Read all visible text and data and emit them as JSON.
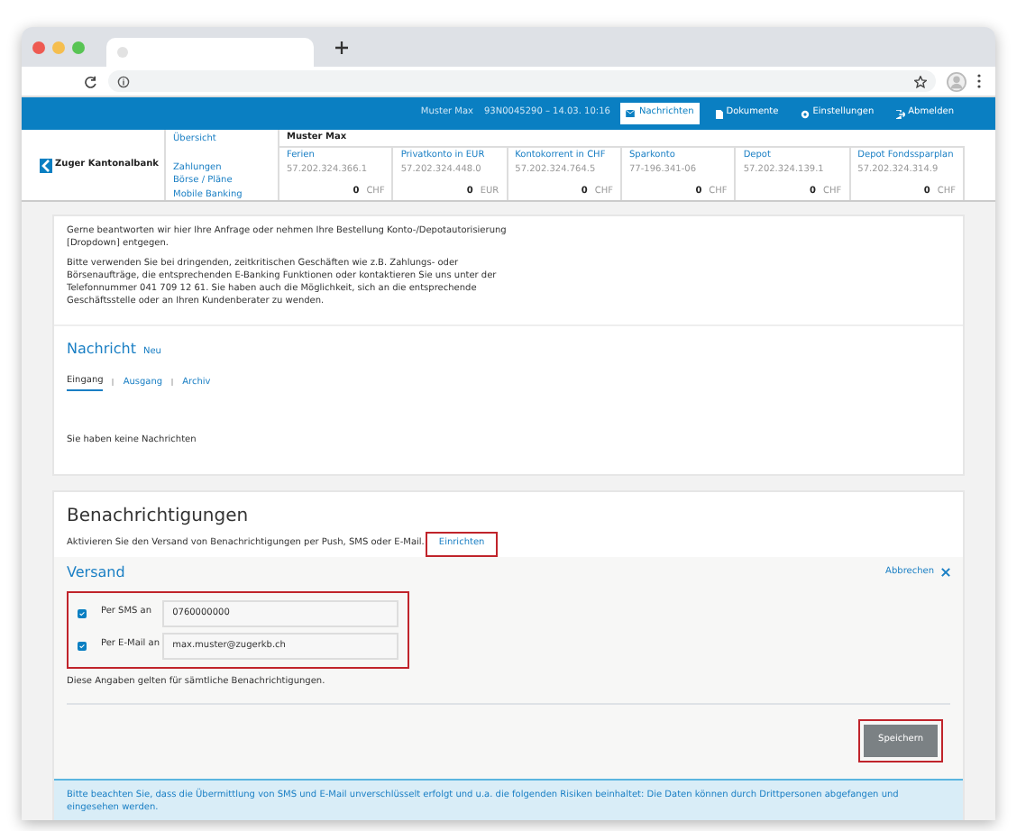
{
  "header": {
    "user": "Muster Max",
    "session": "93N0045290 – 14.03. 10:16",
    "menu": [
      {
        "label": "Nachrichten",
        "selected": true
      },
      {
        "label": "Dokumente",
        "selected": false
      },
      {
        "label": "Einstellungen",
        "selected": false
      },
      {
        "label": "Abmelden",
        "selected": false
      }
    ]
  },
  "nav": {
    "logo": "Zuger Kantonalbank",
    "top_link": "Übersicht",
    "links": [
      "Zahlungen",
      "Börse / Pläne",
      "Mobile Banking"
    ],
    "holder": "Muster Max",
    "accounts": [
      {
        "name": "Ferien",
        "number": "57.202.324.366.1",
        "balance": "0",
        "currency": "CHF"
      },
      {
        "name": "Privatkonto in EUR",
        "number": "57.202.324.448.0",
        "balance": "0",
        "currency": "EUR"
      },
      {
        "name": "Kontokorrent in CHF",
        "number": "57.202.324.764.5",
        "balance": "0",
        "currency": "CHF"
      },
      {
        "name": "Sparkonto",
        "number": "77-196.341-06",
        "balance": "0",
        "currency": "CHF"
      },
      {
        "name": "Depot",
        "number": "57.202.324.139.1",
        "balance": "0",
        "currency": "CHF"
      },
      {
        "name": "Depot Fondssparplan",
        "number": "57.202.324.314.9",
        "balance": "0",
        "currency": "CHF"
      }
    ]
  },
  "intro": [
    "Gerne beantworten wir hier Ihre Anfrage oder nehmen Ihre Bestellung Konto-/Depotautorisierung [Dropdown] entgegen.",
    "Bitte verwenden Sie bei dringenden, zeitkritischen Geschäften wie z.B. Zahlungs- oder Börsenaufträge, die entsprechenden E-Banking Funktionen oder kontaktieren Sie uns unter der Telefonnummer 041 709 12 61. Sie haben auch die Möglichkeit, sich an die entsprechende Geschäftsstelle oder an Ihren Kundenberater zu wenden."
  ],
  "messages": {
    "title": "Nachricht",
    "new_link": "Neu",
    "tabs": [
      {
        "label": "Eingang",
        "selected": true
      },
      {
        "label": "Ausgang",
        "selected": false
      },
      {
        "label": "Archiv",
        "selected": false
      }
    ],
    "empty": "Sie haben keine Nachrichten"
  },
  "notifications": {
    "title": "Benachrichtigungen",
    "text": "Aktivieren Sie den Versand von Benachrichtigungen per Push, SMS oder E-Mail.",
    "setup_link": "Einrichten",
    "setup_highlighted": true,
    "versand": {
      "title": "Versand",
      "cancel": "Abbrechen",
      "channels_highlighted": true,
      "channels": [
        {
          "label": "Per SMS an",
          "checked": true,
          "value": "0760000000"
        },
        {
          "label": "Per E-Mail an",
          "checked": true,
          "value": "max.muster@zugerkb.ch"
        }
      ],
      "note": "Diese Angaben gelten für sämtliche Benachrichtigungen.",
      "save": "Speichern",
      "save_highlighted": true
    },
    "alert": "Bitte beachten Sie, dass die Übermittlung von SMS und E-Mail unverschlüsselt erfolgt und u.a. die folgenden Risiken beinhaltet: Die Daten können durch Drittpersonen abgefangen und eingesehen werden."
  }
}
